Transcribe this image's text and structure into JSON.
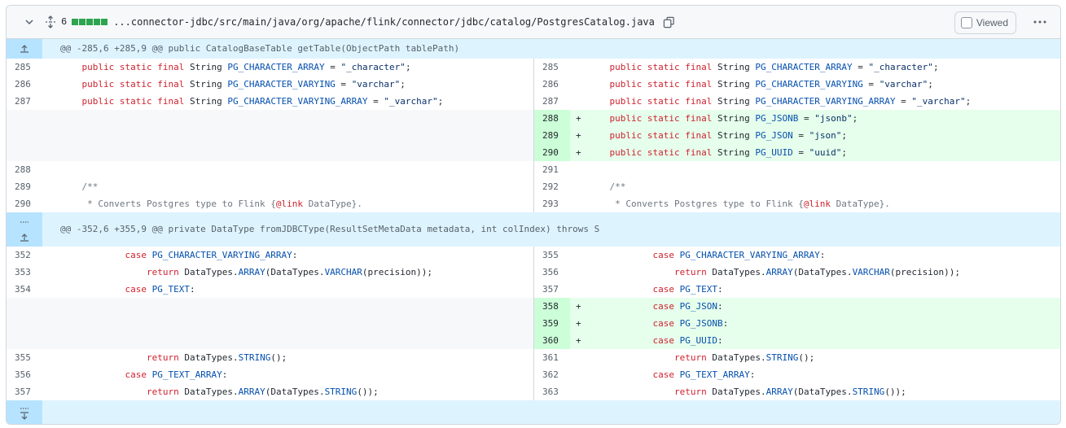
{
  "file": {
    "changes_count": "6",
    "path": "...connector-jdbc/src/main/java/org/apache/flink/connector/jdbc/catalog/PostgresCatalog.java",
    "viewed_label": "Viewed",
    "stat_color": "#2da44e",
    "icons": [
      "chevron-down-icon",
      "unfold-icon",
      "copy-icon",
      "kebab-horizontal-icon",
      "fold-up-icon",
      "fold-down-icon"
    ]
  },
  "rows": [
    {
      "t": "hunk",
      "text": "@@ -285,6 +285,9 @@ public CatalogBaseTable getTable(ObjectPath tablePath)",
      "exp": "up"
    },
    {
      "t": "ctx",
      "l": "285",
      "r": "285",
      "c": "    public static final String PG_CHARACTER_ARRAY = \"_character\";"
    },
    {
      "t": "ctx",
      "l": "286",
      "r": "286",
      "c": "    public static final String PG_CHARACTER_VARYING = \"varchar\";"
    },
    {
      "t": "ctx",
      "l": "287",
      "r": "287",
      "c": "    public static final String PG_CHARACTER_VARYING_ARRAY = \"_varchar\";"
    },
    {
      "t": "add",
      "l": "",
      "r": "288",
      "c": "    public static final String PG_JSONB = \"jsonb\";"
    },
    {
      "t": "add",
      "l": "",
      "r": "289",
      "c": "    public static final String PG_JSON = \"json\";"
    },
    {
      "t": "add",
      "l": "",
      "r": "290",
      "c": "    public static final String PG_UUID = \"uuid\";"
    },
    {
      "t": "ctx",
      "l": "288",
      "r": "291",
      "c": ""
    },
    {
      "t": "ctx",
      "l": "289",
      "r": "292",
      "c": "    /**"
    },
    {
      "t": "ctx",
      "l": "290",
      "r": "293",
      "c": "     * Converts Postgres type to Flink {@link DataType}."
    },
    {
      "t": "hunk2",
      "text": "@@ -352,6 +355,9 @@ private DataType fromJDBCType(ResultSetMetaData metadata, int colIndex) throws S",
      "exp": "both"
    },
    {
      "t": "ctx",
      "l": "352",
      "r": "355",
      "c": "            case PG_CHARACTER_VARYING_ARRAY:"
    },
    {
      "t": "ctx",
      "l": "353",
      "r": "356",
      "c": "                return DataTypes.ARRAY(DataTypes.VARCHAR(precision));"
    },
    {
      "t": "ctx",
      "l": "354",
      "r": "357",
      "c": "            case PG_TEXT:"
    },
    {
      "t": "add",
      "l": "",
      "r": "358",
      "c": "            case PG_JSON:"
    },
    {
      "t": "add",
      "l": "",
      "r": "359",
      "c": "            case PG_JSONB:"
    },
    {
      "t": "add",
      "l": "",
      "r": "360",
      "c": "            case PG_UUID:"
    },
    {
      "t": "ctx",
      "l": "355",
      "r": "361",
      "c": "                return DataTypes.STRING();"
    },
    {
      "t": "ctx",
      "l": "356",
      "r": "362",
      "c": "            case PG_TEXT_ARRAY:"
    },
    {
      "t": "ctx",
      "l": "357",
      "r": "363",
      "c": "                return DataTypes.ARRAY(DataTypes.STRING());"
    },
    {
      "t": "hunkend",
      "text": "",
      "exp": "down"
    }
  ]
}
